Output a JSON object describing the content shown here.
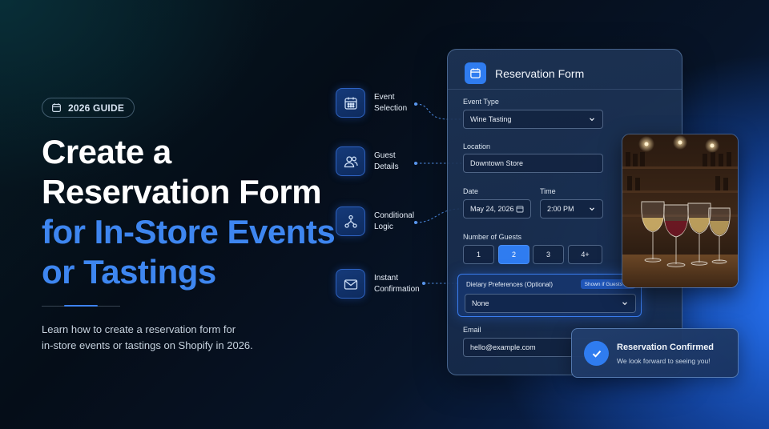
{
  "badge": {
    "icon": "calendar-icon",
    "label": "2026 GUIDE"
  },
  "headline": {
    "line1": "Create a",
    "line2": "Reservation Form",
    "line3": "for In-Store Events",
    "line4": "or Tastings"
  },
  "subtitle": {
    "line1": "Learn how to create a reservation form for",
    "line2": "in-store events or tastings on Shopify in 2026."
  },
  "features": [
    {
      "icon": "calendar-icon",
      "line1": "Event",
      "line2": "Selection"
    },
    {
      "icon": "users-icon",
      "line1": "Guest",
      "line2": "Details"
    },
    {
      "icon": "branch-icon",
      "line1": "Conditional",
      "line2": "Logic"
    },
    {
      "icon": "mail-icon",
      "line1": "Instant",
      "line2": "Confirmation"
    }
  ],
  "form": {
    "title": "Reservation Form",
    "event_type": {
      "label": "Event Type",
      "value": "Wine Tasting"
    },
    "location": {
      "label": "Location",
      "value": "Downtown Store"
    },
    "date": {
      "label": "Date",
      "value": "May 24, 2026"
    },
    "time": {
      "label": "Time",
      "value": "2:00 PM"
    },
    "guests": {
      "label": "Number of Guests",
      "options": [
        "1",
        "2",
        "3",
        "4+"
      ],
      "selected": "2"
    },
    "dietary": {
      "label": "Dietary Preferences (Optional)",
      "tag": "Shown if Guests > 1",
      "value": "None"
    },
    "email": {
      "label": "Email",
      "value": "hello@example.com"
    }
  },
  "confirmation": {
    "title": "Reservation Confirmed",
    "message": "We look forward to seeing you!"
  },
  "colors": {
    "accent": "#2f7cf0",
    "headline_blue": "#3e86f0",
    "bg_dark": "#050d18"
  }
}
